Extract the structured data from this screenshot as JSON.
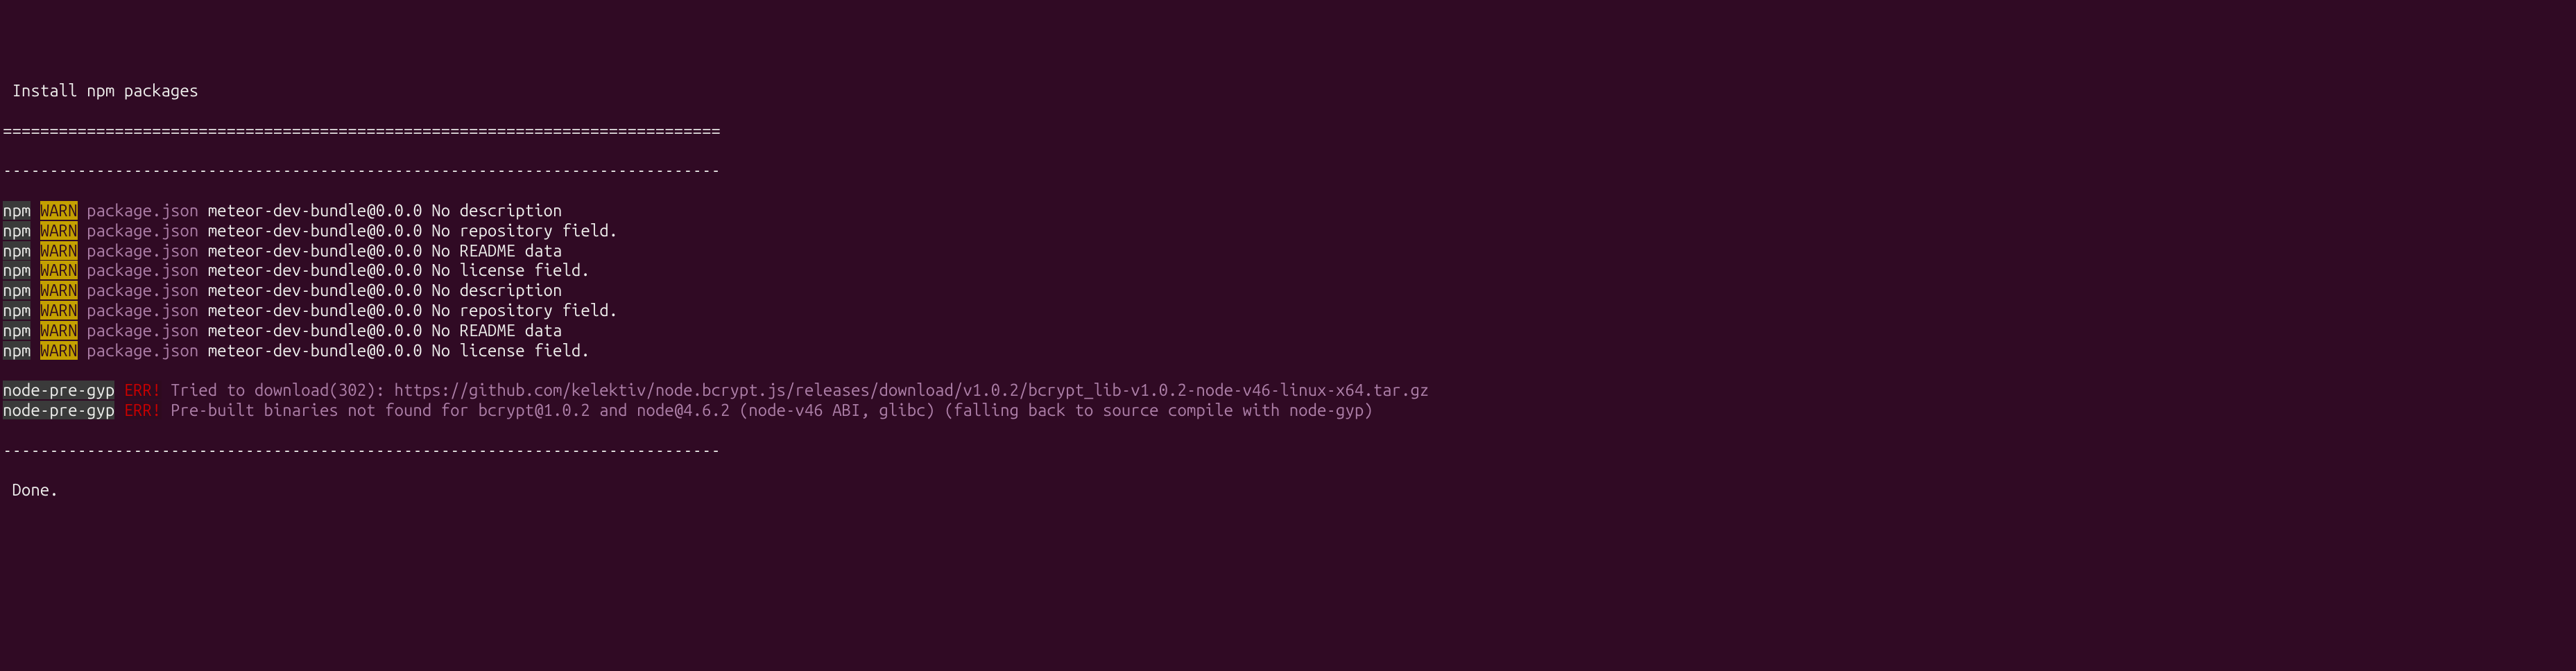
{
  "title": " Install npm packages",
  "divider_eq": "=============================================================================",
  "divider_dash": "-----------------------------------------------------------------------------",
  "warn_lines": [
    {
      "prefix": "npm",
      "level": "WARN",
      "source": "package.json",
      "msg": " meteor-dev-bundle@0.0.0 No description"
    },
    {
      "prefix": "npm",
      "level": "WARN",
      "source": "package.json",
      "msg": " meteor-dev-bundle@0.0.0 No repository field."
    },
    {
      "prefix": "npm",
      "level": "WARN",
      "source": "package.json",
      "msg": " meteor-dev-bundle@0.0.0 No README data"
    },
    {
      "prefix": "npm",
      "level": "WARN",
      "source": "package.json",
      "msg": " meteor-dev-bundle@0.0.0 No license field."
    },
    {
      "prefix": "npm",
      "level": "WARN",
      "source": "package.json",
      "msg": " meteor-dev-bundle@0.0.0 No description"
    },
    {
      "prefix": "npm",
      "level": "WARN",
      "source": "package.json",
      "msg": " meteor-dev-bundle@0.0.0 No repository field."
    },
    {
      "prefix": "npm",
      "level": "WARN",
      "source": "package.json",
      "msg": " meteor-dev-bundle@0.0.0 No README data"
    },
    {
      "prefix": "npm",
      "level": "WARN",
      "source": "package.json",
      "msg": " meteor-dev-bundle@0.0.0 No license field."
    }
  ],
  "err_lines": [
    {
      "prefix": "node-pre-gyp",
      "level": "ERR!",
      "msg": " Tried to download(302): https://github.com/kelektiv/node.bcrypt.js/releases/download/v1.0.2/bcrypt_lib-v1.0.2-node-v46-linux-x64.tar.gz "
    },
    {
      "prefix": "node-pre-gyp",
      "level": "ERR!",
      "msg": " Pre-built binaries not found for bcrypt@1.0.2 and node@4.6.2 (node-v46 ABI, glibc) (falling back to source compile with node-gyp) "
    }
  ],
  "done": " Done."
}
